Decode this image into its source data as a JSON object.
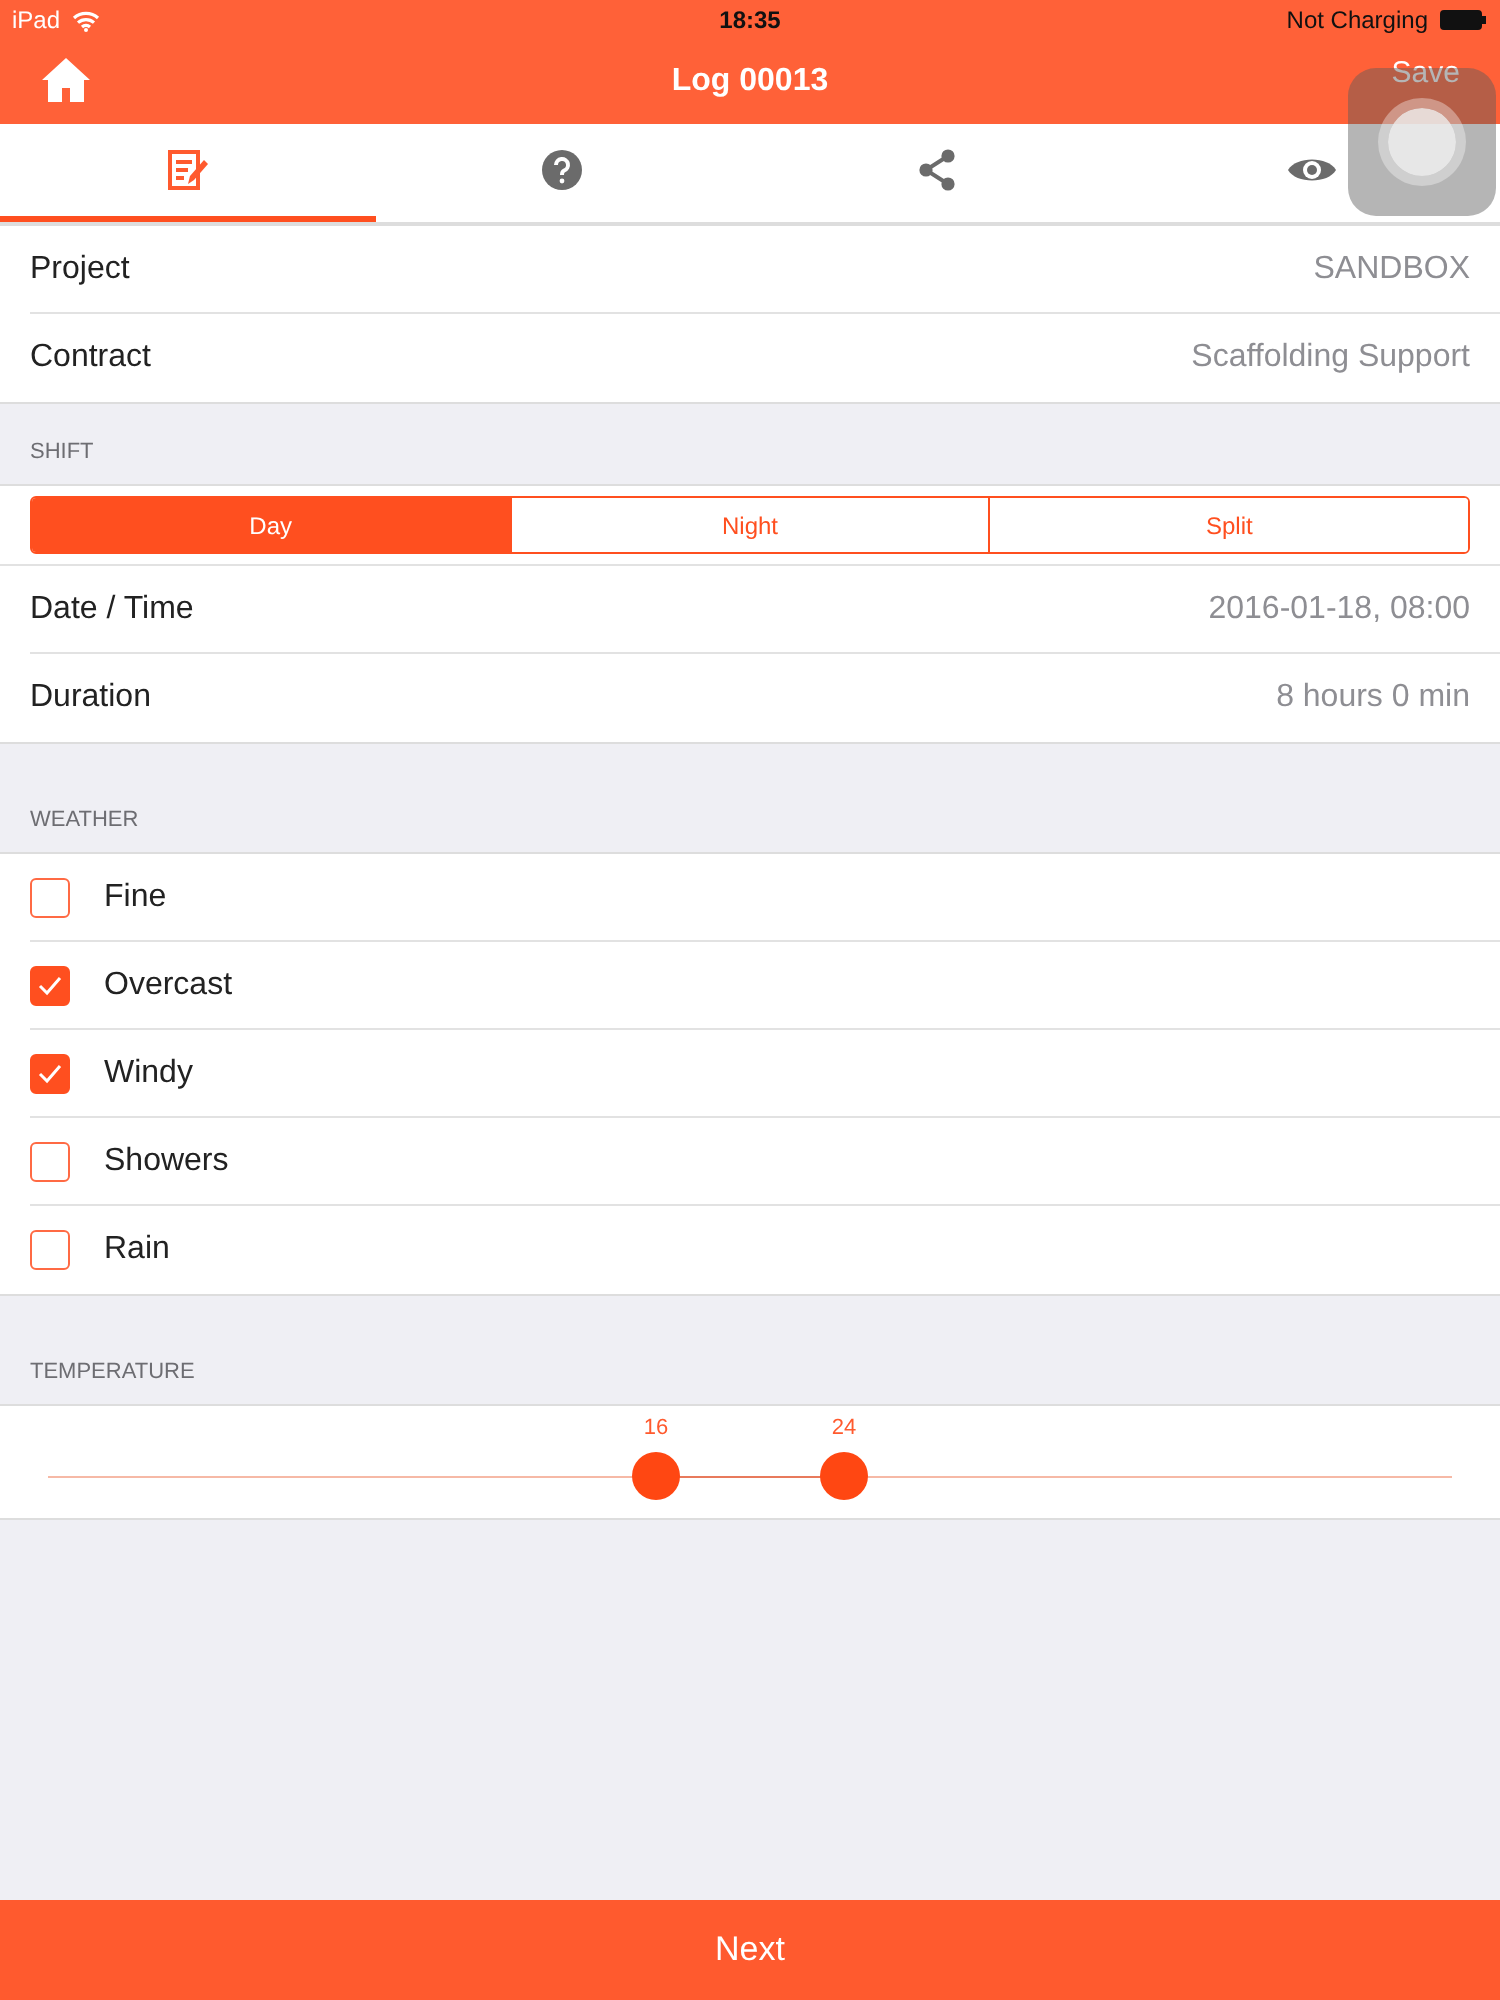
{
  "status_bar": {
    "device": "iPad",
    "time": "18:35",
    "battery_text": "Not Charging"
  },
  "header": {
    "title": "Log 00013",
    "save": "Save"
  },
  "tabs": [
    {
      "selected": true
    },
    {
      "selected": false
    },
    {
      "selected": false
    },
    {
      "selected": false
    }
  ],
  "info_rows": [
    {
      "label": "Project",
      "value": "SANDBOX"
    },
    {
      "label": "Contract",
      "value": "Scaffolding Support"
    }
  ],
  "shift": {
    "title": "SHIFT",
    "options": [
      {
        "label": "Day",
        "selected": true
      },
      {
        "label": "Night",
        "selected": false
      },
      {
        "label": "Split",
        "selected": false
      }
    ]
  },
  "shift_rows": [
    {
      "label": "Date / Time",
      "value": "2016-01-18, 08:00"
    },
    {
      "label": "Duration",
      "value": "8 hours 0 min"
    }
  ],
  "weather": {
    "title": "WEATHER",
    "options": [
      {
        "label": "Fine",
        "checked": false
      },
      {
        "label": "Overcast",
        "checked": true
      },
      {
        "label": "Windy",
        "checked": true
      },
      {
        "label": "Showers",
        "checked": false
      },
      {
        "label": "Rain",
        "checked": false
      }
    ]
  },
  "temperature": {
    "title": "TEMPERATURE",
    "thumbs": [
      {
        "reading": "16",
        "level": 0.433
      },
      {
        "reading": "24",
        "level": 0.567
      }
    ]
  },
  "footer": {
    "button": "Next"
  }
}
